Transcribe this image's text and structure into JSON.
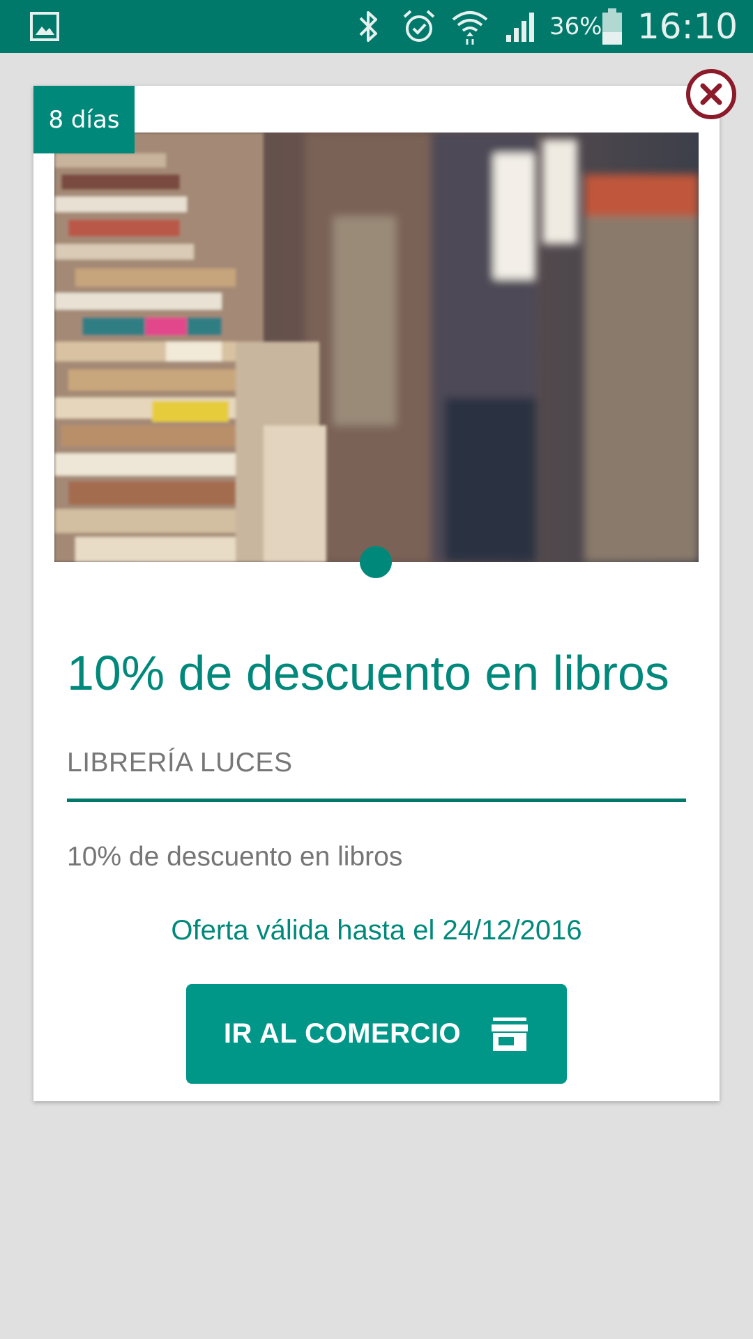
{
  "status_bar": {
    "battery_percent": "36%",
    "time": "16:10",
    "icons": [
      "gallery-icon",
      "bluetooth-icon",
      "alarm-icon",
      "wifi-icon",
      "signal-icon",
      "battery-icon"
    ]
  },
  "offer": {
    "days_badge": "8 días",
    "title": "10% de descuento en libros",
    "merchant": "LIBRERÍA LUCES",
    "description": "10% de descuento en libros",
    "validity": "Oferta válida hasta el 24/12/2016",
    "cta_label": "IR AL COMERCIO",
    "cta_icon": "store-icon",
    "close_icon": "close-icon",
    "image": "bookstore-photo",
    "pager": {
      "current": 1,
      "total": 1
    }
  },
  "colors": {
    "status_bar": "#00796b",
    "accent": "#009688",
    "title": "#00897b",
    "close": "#8b1a2b",
    "background": "#e0e0e0"
  }
}
